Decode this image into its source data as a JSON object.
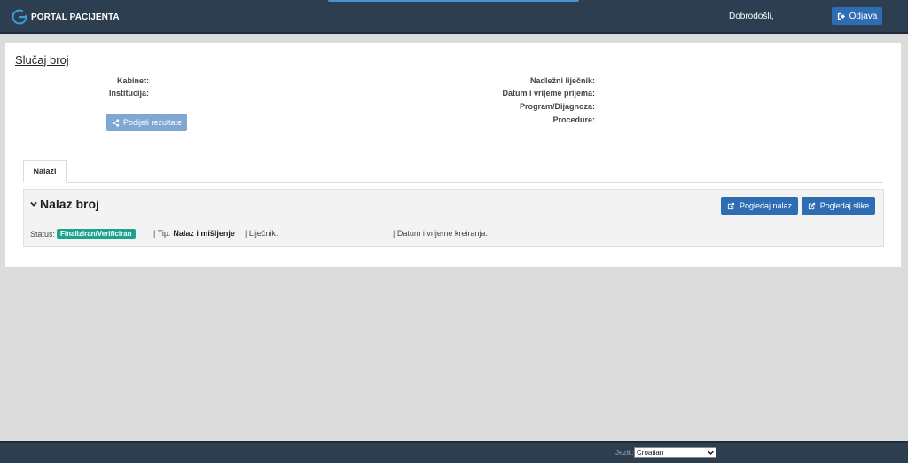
{
  "header": {
    "brand": "PORTAL PACIJENTA",
    "welcome": "Dobrodošli,",
    "logout_label": "Odjava"
  },
  "case": {
    "title": "Slučaj broj",
    "left_fields": [
      "Kabinet:",
      "Institucija:"
    ],
    "right_fields": [
      "Nadležni liječnik:",
      "Datum i vrijeme prijema:",
      "Program/Dijagnoza:",
      "Procedure:"
    ],
    "share_label": "Podijeli rezultate"
  },
  "tabs": [
    {
      "label": "Nalazi",
      "active": true
    }
  ],
  "finding": {
    "title": "Nalaz broj",
    "view_finding_label": "Pogledaj nalaz",
    "view_images_label": "Pogledaj slike",
    "status_label": "Status:",
    "status_value": "Finaliziran/Verificiran",
    "type_label": "| Tip:",
    "type_value": "Nalaz i mišljenje",
    "doctor_label": "| Liječnik:",
    "created_label": "| Datum i vrijeme kreiranja:"
  },
  "footer": {
    "language_label": "Jezik:",
    "language_value": "Croatian"
  },
  "colors": {
    "navbar": "#2c3e50",
    "primary": "#2e6db4",
    "status_green": "#1ba38f"
  }
}
